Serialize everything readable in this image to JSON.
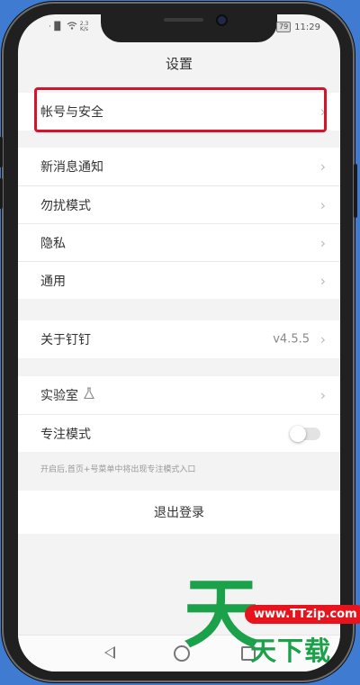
{
  "status_bar": {
    "signal": "·▐▌",
    "net_speed_top": "2.3",
    "net_speed_unit": "K/s",
    "battery": "79",
    "time": "11:29"
  },
  "header": {
    "title": "设置"
  },
  "groups": {
    "account": {
      "label": "帐号与安全"
    },
    "notifications": {
      "new_message": "新消息通知",
      "do_not_disturb": "勿扰模式",
      "privacy": "隐私",
      "general": "通用"
    },
    "about": {
      "label": "关于钉钉",
      "version": "v4.5.5"
    },
    "lab": {
      "label": "实验室",
      "focus_mode": "专注模式",
      "focus_enabled": false
    }
  },
  "hint": "开启后,首页+号菜单中将出现专注模式入口",
  "logout_label": "退出登录",
  "watermark": {
    "logo_char": "天",
    "url": "www.TTzip.com",
    "name": "天下载"
  },
  "colors": {
    "highlight": "#d3142a",
    "watermark_green": "#1ba14a",
    "watermark_red": "#e8141d"
  }
}
